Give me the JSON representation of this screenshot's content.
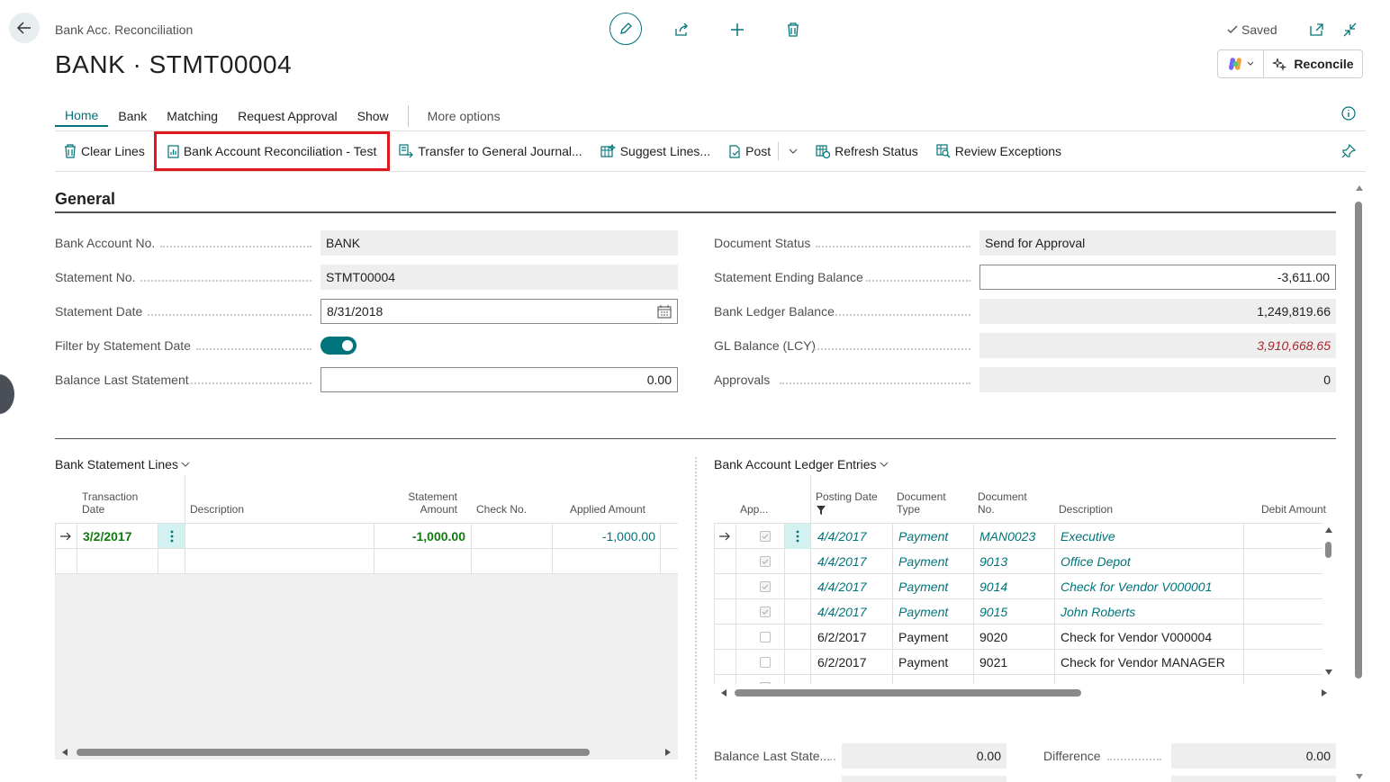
{
  "header": {
    "breadcrumb": "Bank Acc. Reconciliation",
    "title": "BANK · STMT00004",
    "saved_label": "Saved",
    "reconcile_label": "Reconcile"
  },
  "tabs": [
    {
      "label": "Home",
      "active": true
    },
    {
      "label": "Bank"
    },
    {
      "label": "Matching"
    },
    {
      "label": "Request Approval"
    },
    {
      "label": "Show"
    },
    {
      "label": "More options"
    }
  ],
  "actions": [
    {
      "label": "Clear Lines",
      "icon": "trash-icon"
    },
    {
      "label": "Bank Account Reconciliation - Test",
      "icon": "report-icon",
      "highlighted": true
    },
    {
      "label": "Transfer to General Journal...",
      "icon": "transfer-icon"
    },
    {
      "label": "Suggest Lines...",
      "icon": "suggest-icon"
    },
    {
      "label": "Post",
      "icon": "post-icon"
    },
    {
      "label": "Refresh Status",
      "icon": "refresh-icon"
    },
    {
      "label": "Review Exceptions",
      "icon": "review-icon"
    }
  ],
  "general": {
    "section_title": "General",
    "left": [
      {
        "label": "Bank Account No.",
        "value": "BANK"
      },
      {
        "label": "Statement No.",
        "value": "STMT00004"
      },
      {
        "label": "Statement Date",
        "value": "8/31/2018"
      },
      {
        "label": "Filter by Statement Date",
        "value": "on"
      },
      {
        "label": "Balance Last Statement",
        "value": "0.00"
      }
    ],
    "right": [
      {
        "label": "Document Status",
        "value": "Send for Approval"
      },
      {
        "label": "Statement Ending Balance",
        "value": "-3,611.00"
      },
      {
        "label": "Bank Ledger Balance",
        "value": "1,249,819.66"
      },
      {
        "label": "GL Balance (LCY)",
        "value": "3,910,668.65"
      },
      {
        "label": "Approvals",
        "value": "0"
      }
    ]
  },
  "statement_lines": {
    "title": "Bank Statement Lines",
    "columns": [
      "Transaction Date",
      "Description",
      "Statement Amount",
      "Check No.",
      "Applied Amount"
    ],
    "rows": [
      {
        "date": "3/2/2017",
        "description": "",
        "amount": "-1,000.00",
        "check": "",
        "applied": "-1,000.00"
      }
    ]
  },
  "ledger_entries": {
    "title": "Bank Account Ledger Entries",
    "columns": [
      "App...",
      "Posting Date",
      "Document Type",
      "Document No.",
      "Description",
      "Debit Amount"
    ],
    "rows": [
      {
        "applied": true,
        "date": "4/4/2017",
        "type": "Payment",
        "no": "MAN0023",
        "desc": "Executive"
      },
      {
        "applied": true,
        "date": "4/4/2017",
        "type": "Payment",
        "no": "9013",
        "desc": "Office Depot"
      },
      {
        "applied": true,
        "date": "4/4/2017",
        "type": "Payment",
        "no": "9014",
        "desc": "Check for Vendor V000001"
      },
      {
        "applied": true,
        "date": "4/4/2017",
        "type": "Payment",
        "no": "9015",
        "desc": "John Roberts"
      },
      {
        "applied": false,
        "date": "6/2/2017",
        "type": "Payment",
        "no": "9020",
        "desc": "Check for Vendor V000004"
      },
      {
        "applied": false,
        "date": "6/2/2017",
        "type": "Payment",
        "no": "9021",
        "desc": "Check for Vendor MANAGER"
      }
    ]
  },
  "totals": {
    "balance_last_label": "Balance Last State...",
    "balance_last_value": "0.00",
    "difference_label": "Difference",
    "difference_value": "0.00"
  }
}
